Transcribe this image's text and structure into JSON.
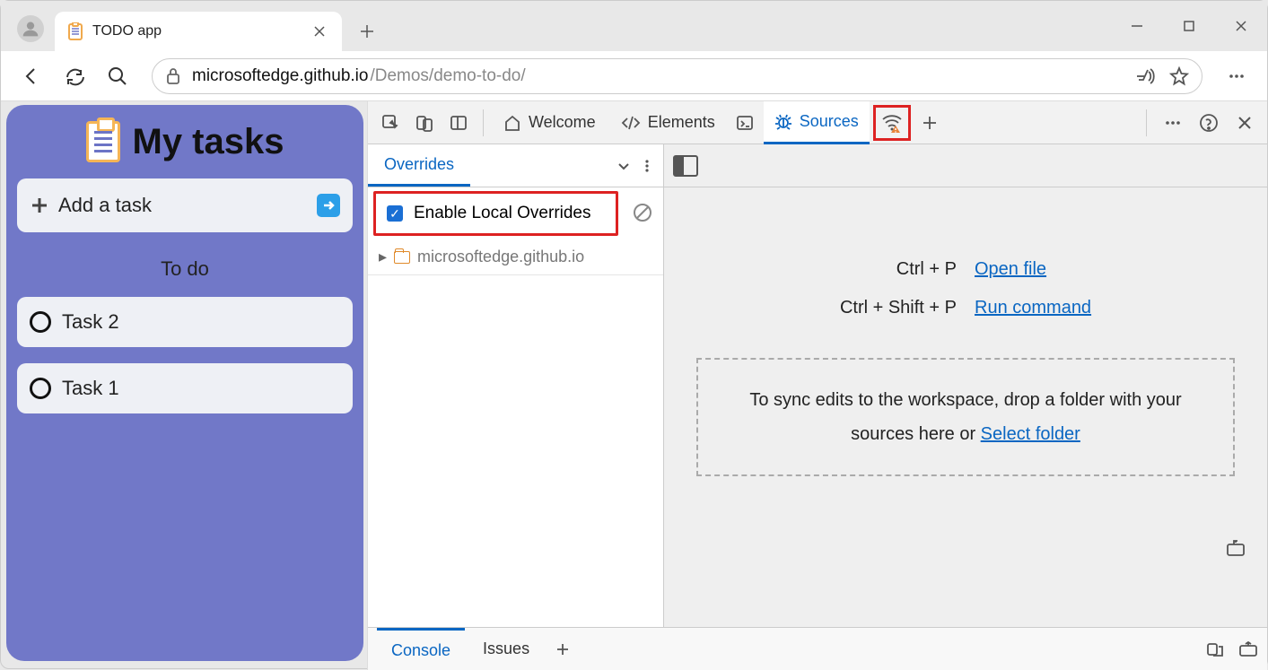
{
  "browser": {
    "tab_title": "TODO app",
    "url_host": "microsoftedge.github.io",
    "url_path": "/Demos/demo-to-do/"
  },
  "todo": {
    "title": "My tasks",
    "add_placeholder": "Add a task",
    "section_label": "To do",
    "tasks": [
      "Task 2",
      "Task 1"
    ]
  },
  "devtools": {
    "tabs": {
      "welcome": "Welcome",
      "elements": "Elements",
      "sources": "Sources"
    },
    "overrides": {
      "tab_label": "Overrides",
      "enable_label": "Enable Local Overrides",
      "enabled": true,
      "domain": "microsoftedge.github.io"
    },
    "rightpane": {
      "open_file_keys": "Ctrl + P",
      "open_file_link": "Open file",
      "run_cmd_keys": "Ctrl + Shift + P",
      "run_cmd_link": "Run command",
      "drop_text_a": "To sync edits to the workspace, drop a folder with your",
      "drop_text_b": "sources here or ",
      "select_folder": "Select folder"
    },
    "drawer": {
      "console": "Console",
      "issues": "Issues"
    }
  }
}
